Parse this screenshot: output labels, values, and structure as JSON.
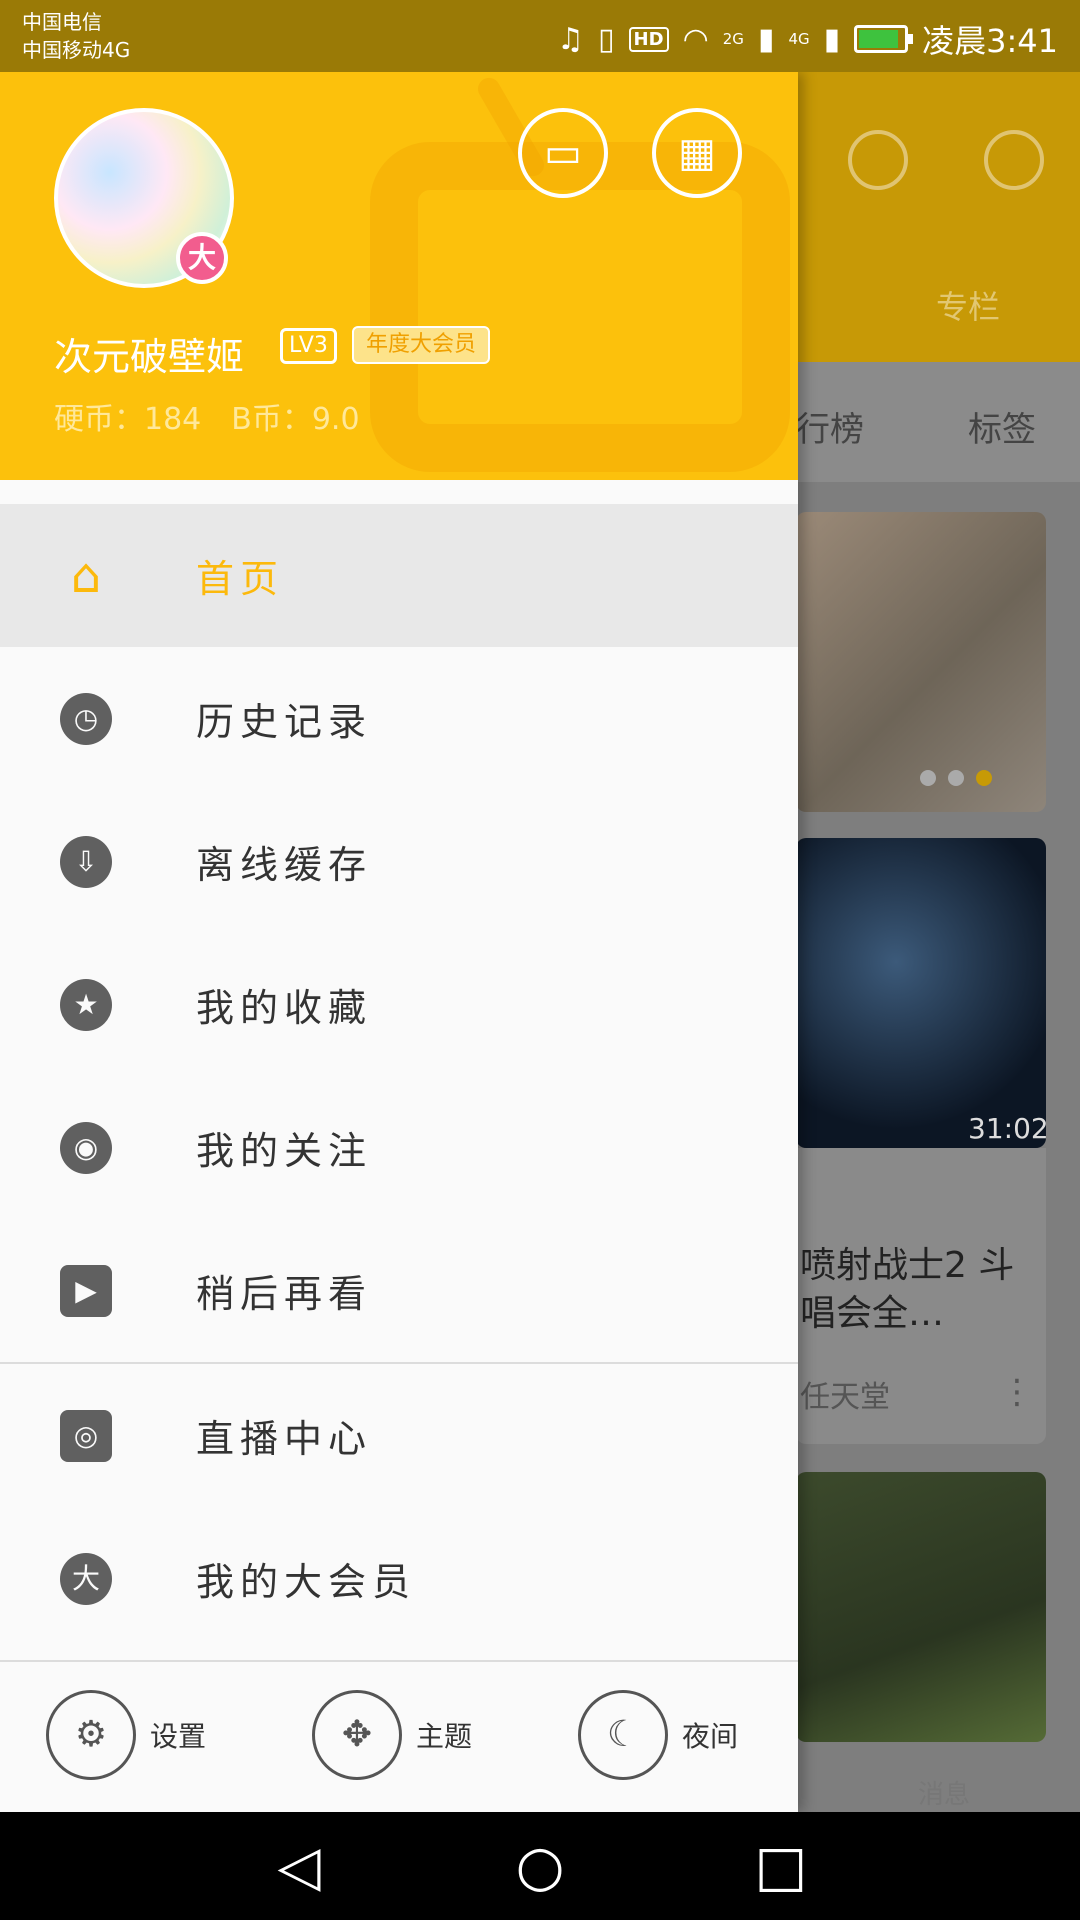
{
  "status_bar": {
    "carrier1": "中国电信",
    "carrier2": "中国移动4G",
    "net1": "2G",
    "net2": "4G",
    "hd": "HD",
    "time": "凌晨3:41"
  },
  "drawer": {
    "header": {
      "username": "次元破壁姬",
      "level": "LV3",
      "vip_label": "年度大会员",
      "avatar_badge": "大",
      "coins_text": "硬币：184　B币：9.0"
    },
    "menu": [
      {
        "label": "首页",
        "icon": "home-icon",
        "glyph": "⌂",
        "active": true
      },
      {
        "label": "历史记录",
        "icon": "clock-icon",
        "glyph": "◷",
        "active": false
      },
      {
        "label": "离线缓存",
        "icon": "cloud-download-icon",
        "glyph": "⇩",
        "active": false
      },
      {
        "label": "我的收藏",
        "icon": "star-icon",
        "glyph": "★",
        "active": false
      },
      {
        "label": "我的关注",
        "icon": "follow-icon",
        "glyph": "◉",
        "active": false
      },
      {
        "label": "稍后再看",
        "icon": "watch-later-icon",
        "glyph": "▶",
        "active": false
      },
      {
        "label": "直播中心",
        "icon": "live-icon",
        "glyph": "◎",
        "active": false
      },
      {
        "label": "我的大会员",
        "icon": "vip-icon",
        "glyph": "大",
        "active": false
      }
    ],
    "footer": {
      "settings": "设置",
      "theme": "主题",
      "night": "夜间"
    }
  },
  "background": {
    "tab_column": "专栏",
    "rank_partial": "行榜",
    "tags": "标签",
    "video_duration": "31:02",
    "video_title_partial": "喷射战士2 斗\n唱会全…",
    "uploader_partial": "任天堂",
    "messages": "消息"
  },
  "colors": {
    "accent": "#fcc10c",
    "active_text": "#fcb90c",
    "vip_badge_bg": "#fde38a",
    "avatar_badge": "#f25d8e"
  }
}
